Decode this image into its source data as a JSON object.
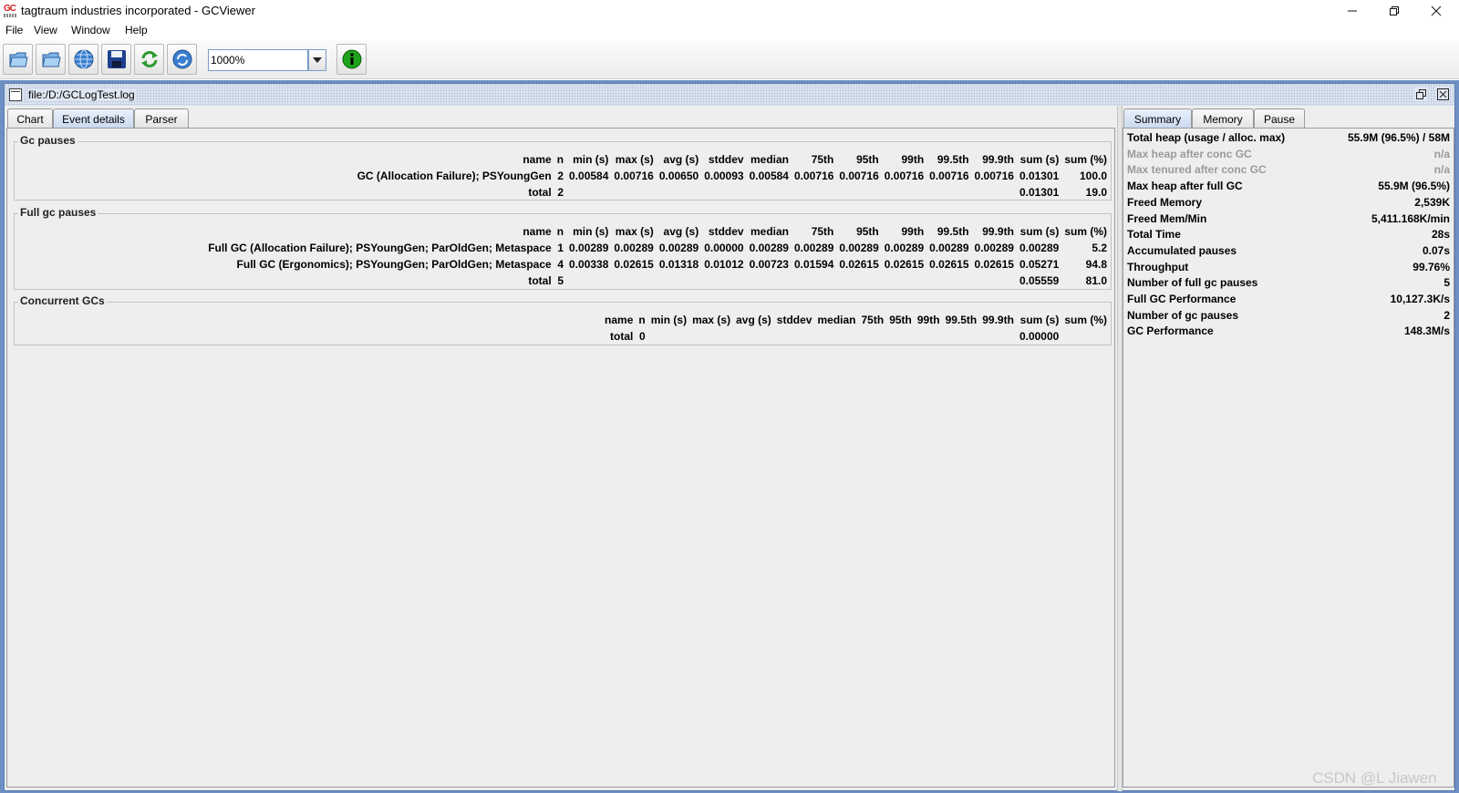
{
  "window": {
    "title": "tagtraum industries incorporated - GCViewer"
  },
  "menu": [
    "File",
    "View",
    "Window",
    "Help"
  ],
  "toolbar": {
    "zoom": "1000%"
  },
  "document": {
    "title": "file:/D:/GCLogTest.log"
  },
  "tabs_left": [
    "Chart",
    "Event details",
    "Parser"
  ],
  "tabs_right": [
    "Summary",
    "Memory",
    "Pause"
  ],
  "gc_pauses": {
    "title": "Gc pauses",
    "headers": [
      "name",
      "n",
      "min (s)",
      "max (s)",
      "avg (s)",
      "stddev",
      "median",
      "75th",
      "95th",
      "99th",
      "99.5th",
      "99.9th",
      "sum (s)",
      "sum (%)"
    ],
    "rows": [
      [
        "GC (Allocation Failure); PSYoungGen",
        "2",
        "0.00584",
        "0.00716",
        "0.00650",
        "0.00093",
        "0.00584",
        "0.00716",
        "0.00716",
        "0.00716",
        "0.00716",
        "0.00716",
        "0.01301",
        "100.0"
      ],
      [
        "total",
        "2",
        "",
        "",
        "",
        "",
        "",
        "",
        "",
        "",
        "",
        "",
        "0.01301",
        "19.0"
      ]
    ]
  },
  "full_gc_pauses": {
    "title": "Full gc pauses",
    "headers": [
      "name",
      "n",
      "min (s)",
      "max (s)",
      "avg (s)",
      "stddev",
      "median",
      "75th",
      "95th",
      "99th",
      "99.5th",
      "99.9th",
      "sum (s)",
      "sum (%)"
    ],
    "rows": [
      [
        "Full GC (Allocation Failure); PSYoungGen; ParOldGen; Metaspace",
        "1",
        "0.00289",
        "0.00289",
        "0.00289",
        "0.00000",
        "0.00289",
        "0.00289",
        "0.00289",
        "0.00289",
        "0.00289",
        "0.00289",
        "0.00289",
        "5.2"
      ],
      [
        "Full GC (Ergonomics); PSYoungGen; ParOldGen; Metaspace",
        "4",
        "0.00338",
        "0.02615",
        "0.01318",
        "0.01012",
        "0.00723",
        "0.01594",
        "0.02615",
        "0.02615",
        "0.02615",
        "0.02615",
        "0.05271",
        "94.8"
      ],
      [
        "total",
        "5",
        "",
        "",
        "",
        "",
        "",
        "",
        "",
        "",
        "",
        "",
        "0.05559",
        "81.0"
      ]
    ]
  },
  "concurrent_gcs": {
    "title": "Concurrent GCs",
    "headers": [
      "name",
      "n",
      "min (s)",
      "max (s)",
      "avg (s)",
      "stddev",
      "median",
      "75th",
      "95th",
      "99th",
      "99.5th",
      "99.9th",
      "sum (s)",
      "sum (%)"
    ],
    "rows": [
      [
        "total",
        "0",
        "",
        "",
        "",
        "",
        "",
        "",
        "",
        "",
        "",
        "",
        "0.00000",
        ""
      ]
    ]
  },
  "summary": [
    {
      "label": "Total heap (usage / alloc. max)",
      "value": "55.9M (96.5%) / 58M",
      "dim": false
    },
    {
      "label": "Max heap after conc GC",
      "value": "n/a",
      "dim": true
    },
    {
      "label": "Max tenured after conc GC",
      "value": "n/a",
      "dim": true
    },
    {
      "label": "Max heap after full GC",
      "value": "55.9M (96.5%)",
      "dim": false
    },
    {
      "label": "Freed Memory",
      "value": "2,539K",
      "dim": false
    },
    {
      "label": "Freed Mem/Min",
      "value": "5,411.168K/min",
      "dim": false
    },
    {
      "label": "Total Time",
      "value": "28s",
      "dim": false
    },
    {
      "label": "Accumulated pauses",
      "value": "0.07s",
      "dim": false
    },
    {
      "label": "Throughput",
      "value": "99.76%",
      "dim": false
    },
    {
      "label": "Number of full gc pauses",
      "value": "5",
      "dim": false
    },
    {
      "label": "Full GC Performance",
      "value": "10,127.3K/s",
      "dim": false
    },
    {
      "label": "Number of gc pauses",
      "value": "2",
      "dim": false
    },
    {
      "label": "GC Performance",
      "value": "148.3M/s",
      "dim": false
    }
  ],
  "watermark": "CSDN @L Jiawen"
}
